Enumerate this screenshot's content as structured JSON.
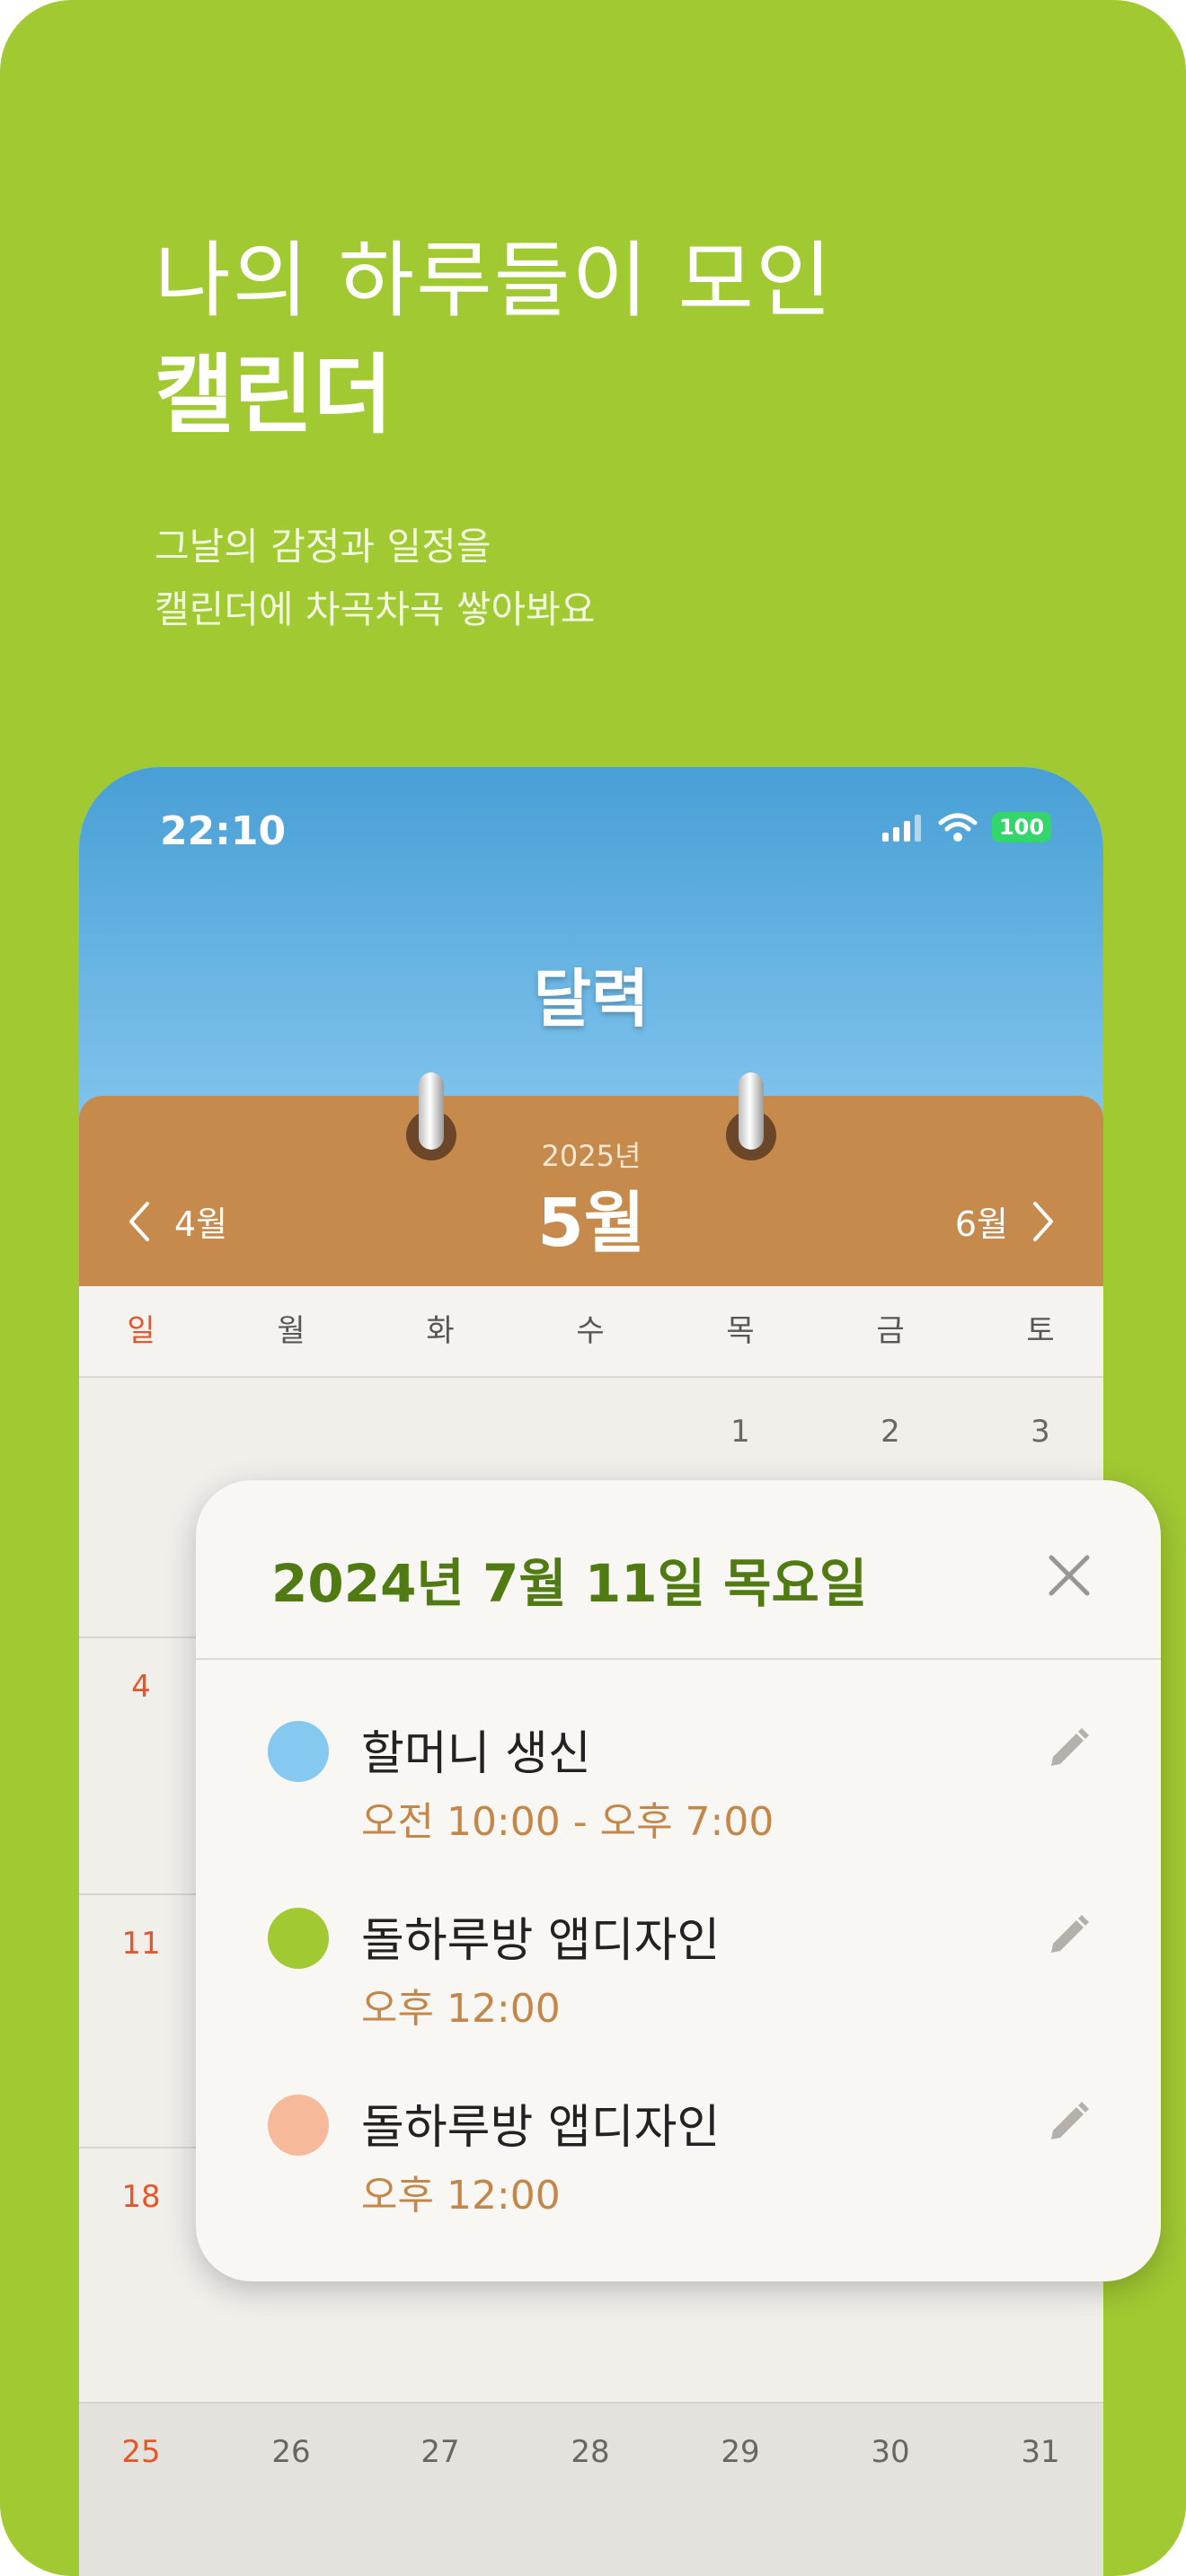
{
  "promo": {
    "headline_line1": "나의 하루들이 모인",
    "headline_line2": "캘린더",
    "subtitle_line1": "그날의 감정과 일정을",
    "subtitle_line2": "캘린더에 차곡차곡 쌓아봐요"
  },
  "status_bar": {
    "time": "22:10",
    "battery": "100",
    "icons": [
      "cellular-signal-icon",
      "wifi-icon",
      "battery-icon"
    ]
  },
  "screen": {
    "title": "달력"
  },
  "calendar_header": {
    "year": "2025년",
    "month": "5월",
    "prev_month": "4월",
    "next_month": "6월"
  },
  "weekdays": [
    "일",
    "월",
    "화",
    "수",
    "목",
    "금",
    "토"
  ],
  "weeks": [
    [
      "",
      "",
      "",
      "",
      "1",
      "2",
      "3"
    ],
    [
      "4",
      "",
      "",
      "",
      "",
      "",
      ""
    ],
    [
      "11",
      "",
      "",
      "",
      "",
      "",
      ""
    ],
    [
      "18",
      "",
      "",
      "",
      "",
      "",
      ""
    ],
    [
      "25",
      "26",
      "27",
      "28",
      "29",
      "30",
      "31"
    ]
  ],
  "modal": {
    "date": "2024년 7월 11일 목요일",
    "events": [
      {
        "title": "할머니 생신",
        "time": "오전 10:00 - 오후 7:00",
        "color": "#85c8f0"
      },
      {
        "title": "돌하루방 앱디자인",
        "time": "오후 12:00",
        "color": "#a0c932"
      },
      {
        "title": "돌하루방 앱디자인",
        "time": "오후 12:00",
        "color": "#f6b999"
      }
    ]
  },
  "colors": {
    "background_green": "#a0c932",
    "sky_top": "#489fd5",
    "board_brown": "#c68a4c",
    "sunday_red": "#e2572b",
    "modal_date_green": "#4f7b12",
    "event_time_brown": "#c4874a"
  }
}
